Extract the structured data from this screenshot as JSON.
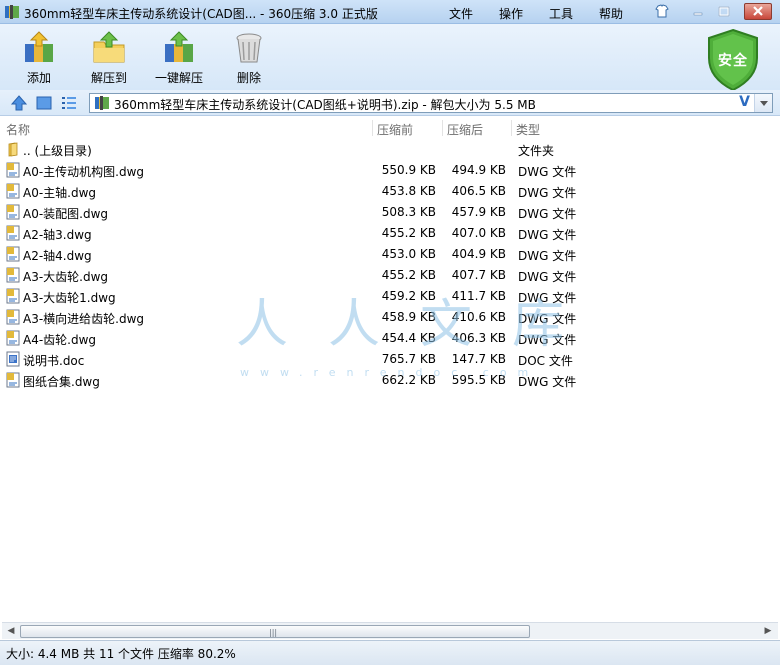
{
  "window": {
    "title": "360mm轻型车床主传动系统设计(CAD图... - 360压缩 3.0 正式版"
  },
  "menu": [
    "文件",
    "操作",
    "工具",
    "帮助"
  ],
  "toolbar": {
    "add_label": "添加",
    "extract_to_label": "解压到",
    "one_click_extract_label": "一键解压",
    "delete_label": "删除",
    "security_badge": "安全"
  },
  "address": {
    "path": "360mm轻型车床主传动系统设计(CAD图纸+说明书).zip - 解包大小为 5.5 MB",
    "dropdown_glyph": "V"
  },
  "columns": {
    "name": "名称",
    "compressed": "压缩前",
    "original": "压缩后",
    "type": "类型"
  },
  "files": [
    {
      "name": ".. (上级目录)",
      "before": "",
      "after": "",
      "type": "文件夹",
      "icon": "folder-icon"
    },
    {
      "name": "A0-主传动机构图.dwg",
      "before": "550.9 KB",
      "after": "494.9 KB",
      "type": "DWG 文件",
      "icon": "dwg-file-icon"
    },
    {
      "name": "A0-主轴.dwg",
      "before": "453.8 KB",
      "after": "406.5 KB",
      "type": "DWG 文件",
      "icon": "dwg-file-icon"
    },
    {
      "name": "A0-装配图.dwg",
      "before": "508.3 KB",
      "after": "457.9 KB",
      "type": "DWG 文件",
      "icon": "dwg-file-icon"
    },
    {
      "name": "A2-轴3.dwg",
      "before": "455.2 KB",
      "after": "407.0 KB",
      "type": "DWG 文件",
      "icon": "dwg-file-icon"
    },
    {
      "name": "A2-轴4.dwg",
      "before": "453.0 KB",
      "after": "404.9 KB",
      "type": "DWG 文件",
      "icon": "dwg-file-icon"
    },
    {
      "name": "A3-大齿轮.dwg",
      "before": "455.2 KB",
      "after": "407.7 KB",
      "type": "DWG 文件",
      "icon": "dwg-file-icon"
    },
    {
      "name": "A3-大齿轮1.dwg",
      "before": "459.2 KB",
      "after": "411.7 KB",
      "type": "DWG 文件",
      "icon": "dwg-file-icon"
    },
    {
      "name": "A3-横向进给齿轮.dwg",
      "before": "458.9 KB",
      "after": "410.6 KB",
      "type": "DWG 文件",
      "icon": "dwg-file-icon"
    },
    {
      "name": "A4-齿轮.dwg",
      "before": "454.4 KB",
      "after": "406.3 KB",
      "type": "DWG 文件",
      "icon": "dwg-file-icon"
    },
    {
      "name": "说明书.doc",
      "before": "765.7 KB",
      "after": "147.7 KB",
      "type": "DOC 文件",
      "icon": "doc-file-icon"
    },
    {
      "name": "图纸合集.dwg",
      "before": "662.2 KB",
      "after": "595.5 KB",
      "type": "DWG 文件",
      "icon": "dwg-file-icon"
    }
  ],
  "watermark": {
    "big": "人人文库",
    "small": "www.renrendoc.com"
  },
  "status": {
    "text": "大小: 4.4 MB 共 11 个文件 压缩率 80.2%"
  },
  "colors": {
    "titlebar": "#c3dbf4",
    "toolbar": "#dfecf9",
    "shield": "#4fae3a",
    "watermark": "#8fc3e6"
  }
}
